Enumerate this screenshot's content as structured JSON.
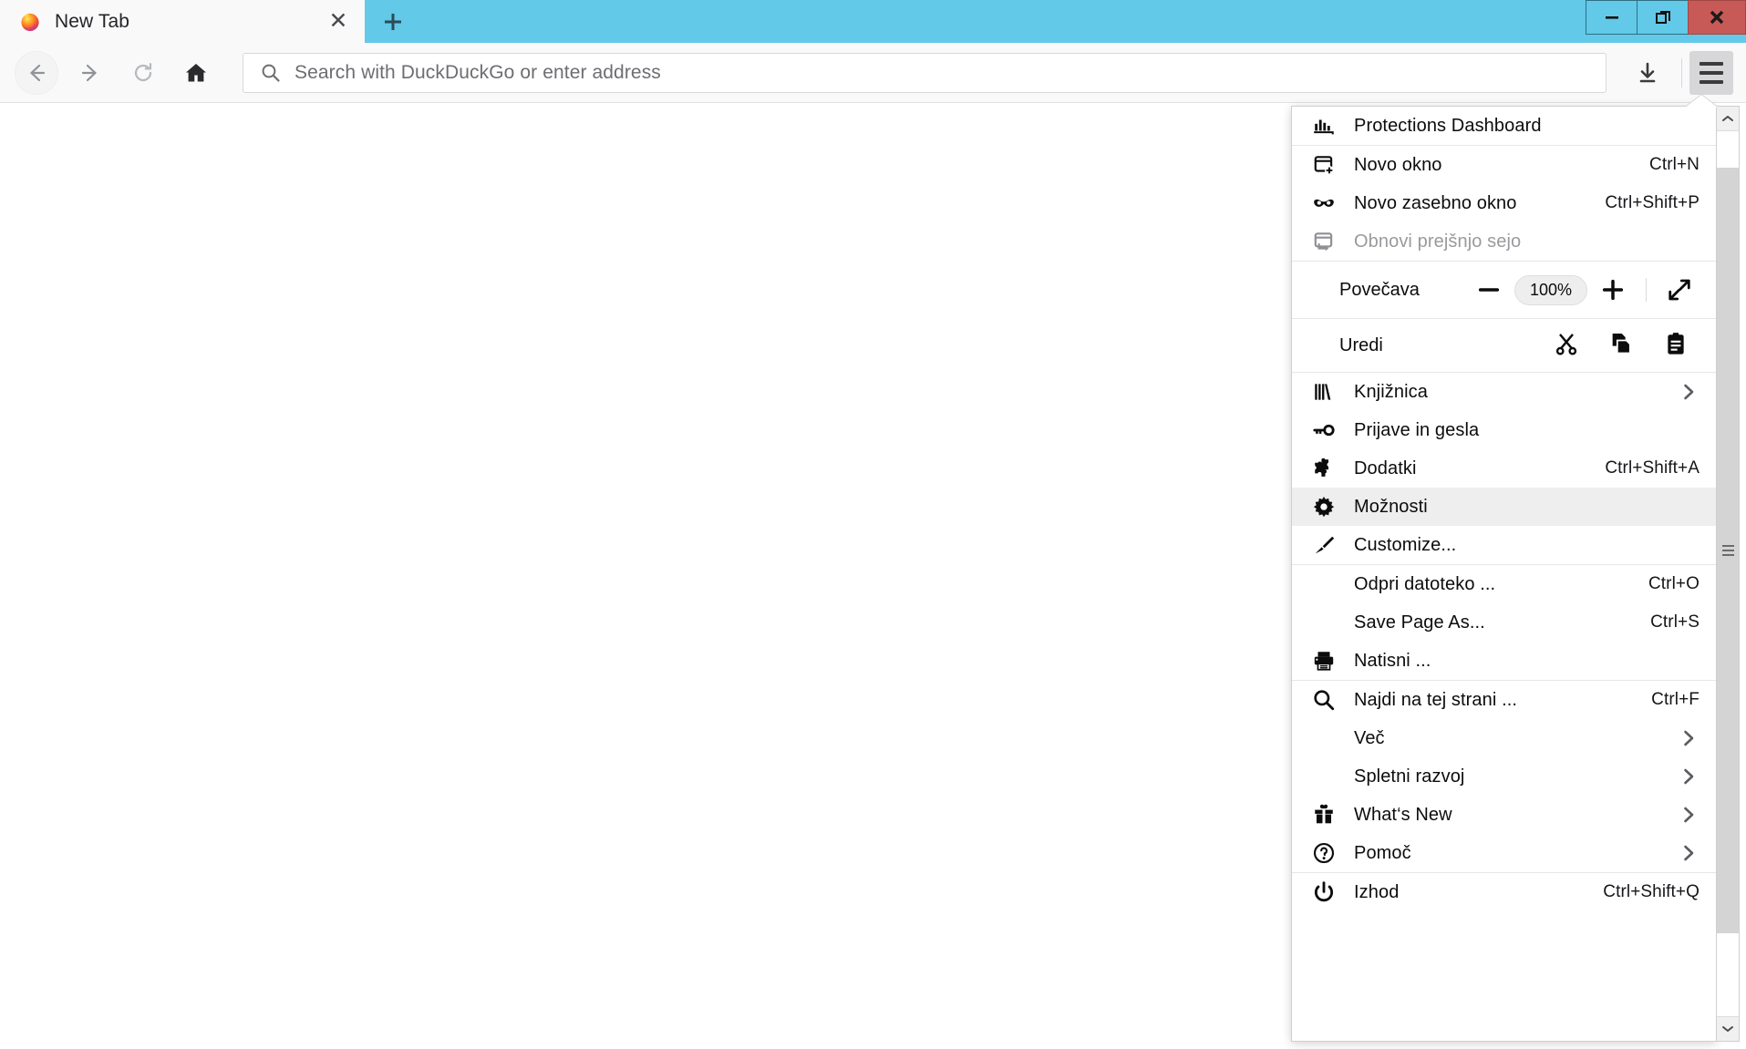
{
  "window": {
    "controls": [
      {
        "name": "minimize",
        "glyph": "–"
      },
      {
        "name": "restore",
        "glyph": "❐"
      },
      {
        "name": "close",
        "glyph": "✕"
      }
    ],
    "close_color": "#c75a56",
    "titlebar_color": "#62c9e8"
  },
  "tabs": {
    "active": {
      "title": "New Tab",
      "favicon": "firefox-logo",
      "close_glyph": "✕"
    },
    "newtab_glyph": "+"
  },
  "toolbar": {
    "back": "back-arrow",
    "forward": "forward-arrow",
    "reload": "reload-arrow",
    "home": "home-house",
    "downloads": "download-arrow",
    "menu": "hamburger",
    "urlbar": {
      "placeholder": "Search with DuckDuckGo or enter address",
      "value": "",
      "icon": "search-magnifier"
    }
  },
  "menu": {
    "sections": [
      {
        "id": "protections",
        "items": [
          {
            "label": "Protections Dashboard",
            "icon": "chart-bars",
            "shortcut": "",
            "chevron": false,
            "state": "normal"
          }
        ]
      },
      {
        "id": "windows",
        "items": [
          {
            "label": "Novo okno",
            "icon": "new-window",
            "shortcut": "Ctrl+N",
            "chevron": false,
            "state": "normal"
          },
          {
            "label": "Novo zasebno okno",
            "icon": "private-mask",
            "shortcut": "Ctrl+Shift+P",
            "chevron": false,
            "state": "normal"
          },
          {
            "label": "Obnovi prejšnjo sejo",
            "icon": "restore-session",
            "shortcut": "",
            "chevron": false,
            "state": "disabled"
          }
        ]
      },
      {
        "id": "zoom",
        "type": "zoom",
        "label": "Povečava",
        "minus_glyph": "−",
        "value": "100%",
        "plus_glyph": "+",
        "fullscreen_icon": "fullscreen-arrows"
      },
      {
        "id": "edit",
        "type": "edit",
        "label": "Uredi",
        "buttons": [
          {
            "icon": "scissors-cut"
          },
          {
            "icon": "copy-pages"
          },
          {
            "icon": "clipboard-paste"
          }
        ]
      },
      {
        "id": "library",
        "items": [
          {
            "label": "Knjižnica",
            "icon": "library-books",
            "shortcut": "",
            "chevron": true,
            "state": "normal"
          },
          {
            "label": "Prijave in gesla",
            "icon": "key",
            "shortcut": "",
            "chevron": false,
            "state": "normal"
          },
          {
            "label": "Dodatki",
            "icon": "puzzle-piece",
            "shortcut": "Ctrl+Shift+A",
            "chevron": false,
            "state": "normal"
          },
          {
            "label": "Možnosti",
            "icon": "gear",
            "shortcut": "",
            "chevron": false,
            "state": "hover"
          },
          {
            "label": "Customize...",
            "icon": "paintbrush",
            "shortcut": "",
            "chevron": false,
            "state": "normal"
          }
        ]
      },
      {
        "id": "file",
        "items": [
          {
            "label": "Odpri datoteko ...",
            "icon": "",
            "shortcut": "Ctrl+O",
            "chevron": false,
            "state": "normal"
          },
          {
            "label": "Save Page As...",
            "icon": "",
            "shortcut": "Ctrl+S",
            "chevron": false,
            "state": "normal"
          },
          {
            "label": "Natisni ...",
            "icon": "printer",
            "shortcut": "",
            "chevron": false,
            "state": "normal"
          }
        ]
      },
      {
        "id": "tools",
        "items": [
          {
            "label": "Najdi na tej strani ...",
            "icon": "search-magnifier",
            "shortcut": "Ctrl+F",
            "chevron": false,
            "state": "normal"
          },
          {
            "label": "Več",
            "icon": "",
            "shortcut": "",
            "chevron": true,
            "state": "normal"
          },
          {
            "label": "Spletni razvoj",
            "icon": "",
            "shortcut": "",
            "chevron": true,
            "state": "normal"
          },
          {
            "label": "What‘s New",
            "icon": "gift-box",
            "shortcut": "",
            "chevron": true,
            "state": "normal"
          },
          {
            "label": "Pomoč",
            "icon": "question-circle",
            "shortcut": "",
            "chevron": true,
            "state": "normal"
          }
        ]
      },
      {
        "id": "exit",
        "items": [
          {
            "label": "Izhod",
            "icon": "power",
            "shortcut": "Ctrl+Shift+Q",
            "chevron": false,
            "state": "normal"
          }
        ]
      }
    ],
    "scrollbar": {
      "up_glyph": "⌃",
      "down_glyph": "⌄"
    }
  }
}
